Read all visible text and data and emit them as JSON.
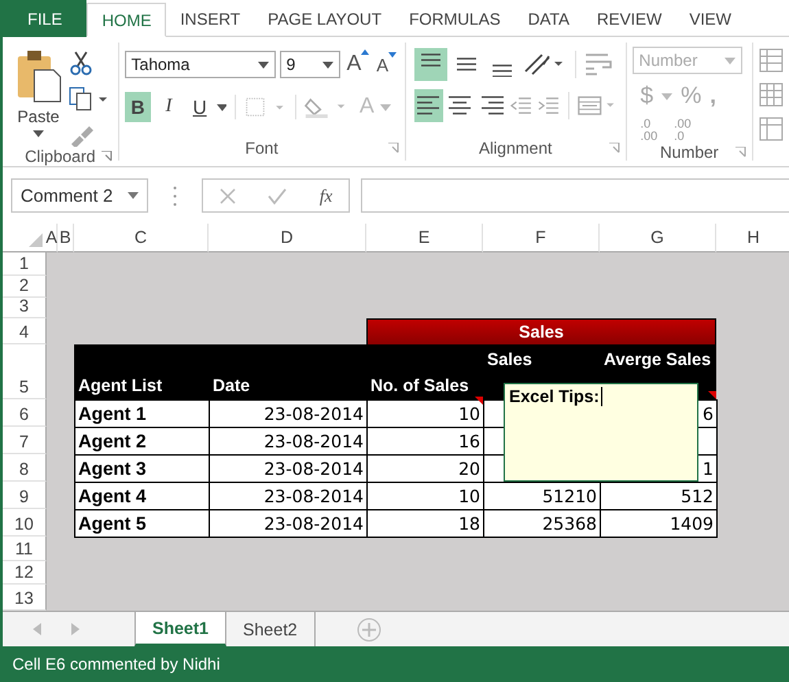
{
  "ribbon_tabs": [
    {
      "label": "FILE",
      "kind": "file",
      "selected": false
    },
    {
      "label": "HOME",
      "kind": "tab",
      "selected": true
    },
    {
      "label": "INSERT",
      "kind": "tab",
      "selected": false
    },
    {
      "label": "PAGE LAYOUT",
      "kind": "tab",
      "selected": false
    },
    {
      "label": "FORMULAS",
      "kind": "tab",
      "selected": false
    },
    {
      "label": "DATA",
      "kind": "tab",
      "selected": false
    },
    {
      "label": "REVIEW",
      "kind": "tab",
      "selected": false
    },
    {
      "label": "VIEW",
      "kind": "tab",
      "selected": false
    }
  ],
  "clipboard": {
    "paste_label": "Paste",
    "group_label": "Clipboard"
  },
  "font": {
    "family": "Tahoma",
    "size": "9",
    "grow_letter": "A",
    "shrink_letter": "A",
    "bold": {
      "label": "B",
      "on": true
    },
    "italic": {
      "label": "I",
      "on": false
    },
    "underline": {
      "label": "U",
      "on": false
    },
    "color_letter": "A",
    "group_label": "Font"
  },
  "alignment": {
    "group_label": "Alignment",
    "buttons": [
      {
        "kind": "top",
        "on": true
      },
      {
        "kind": "middle",
        "on": false
      },
      {
        "kind": "bottom",
        "on": false
      },
      {
        "kind": "left",
        "on": true
      },
      {
        "kind": "center",
        "on": false
      },
      {
        "kind": "right",
        "on": false
      }
    ]
  },
  "number": {
    "format": "Number",
    "disabled": true,
    "currency": "$",
    "percent": "%",
    "comma": ",",
    "decimals": [
      {
        "top": ".0",
        "bottom": ".00"
      },
      {
        "top": ".00",
        "bottom": ".0"
      }
    ],
    "group_label": "Number"
  },
  "name_box": "Comment 2",
  "fx": "fx",
  "columns": [
    "A",
    "B",
    "C",
    "D",
    "E",
    "F",
    "G",
    "H"
  ],
  "row_numbers": [
    "1",
    "2",
    "3",
    "4",
    "5",
    "6",
    "7",
    "8",
    "9",
    "10",
    "11",
    "12",
    "13"
  ],
  "table": {
    "group_header": "Sales",
    "headers": [
      "Agent List",
      "Date",
      "No. of Sales",
      "Sales",
      "Averge Sales"
    ],
    "rows": [
      [
        "Agent 1",
        "23-08-2014",
        "10",
        "",
        "6"
      ],
      [
        "Agent 2",
        "23-08-2014",
        "16",
        "",
        ""
      ],
      [
        "Agent 3",
        "23-08-2014",
        "20",
        "",
        "1"
      ],
      [
        "Agent 4",
        "23-08-2014",
        "10",
        "51210",
        "512"
      ],
      [
        "Agent 5",
        "23-08-2014",
        "18",
        "25368",
        "1409"
      ]
    ]
  },
  "comment": {
    "title": "Excel Tips:"
  },
  "sheet_tabs": [
    {
      "label": "Sheet1",
      "selected": true
    },
    {
      "label": "Sheet2",
      "selected": false
    }
  ],
  "status_bar": "Cell E6 commented by Nidhi"
}
